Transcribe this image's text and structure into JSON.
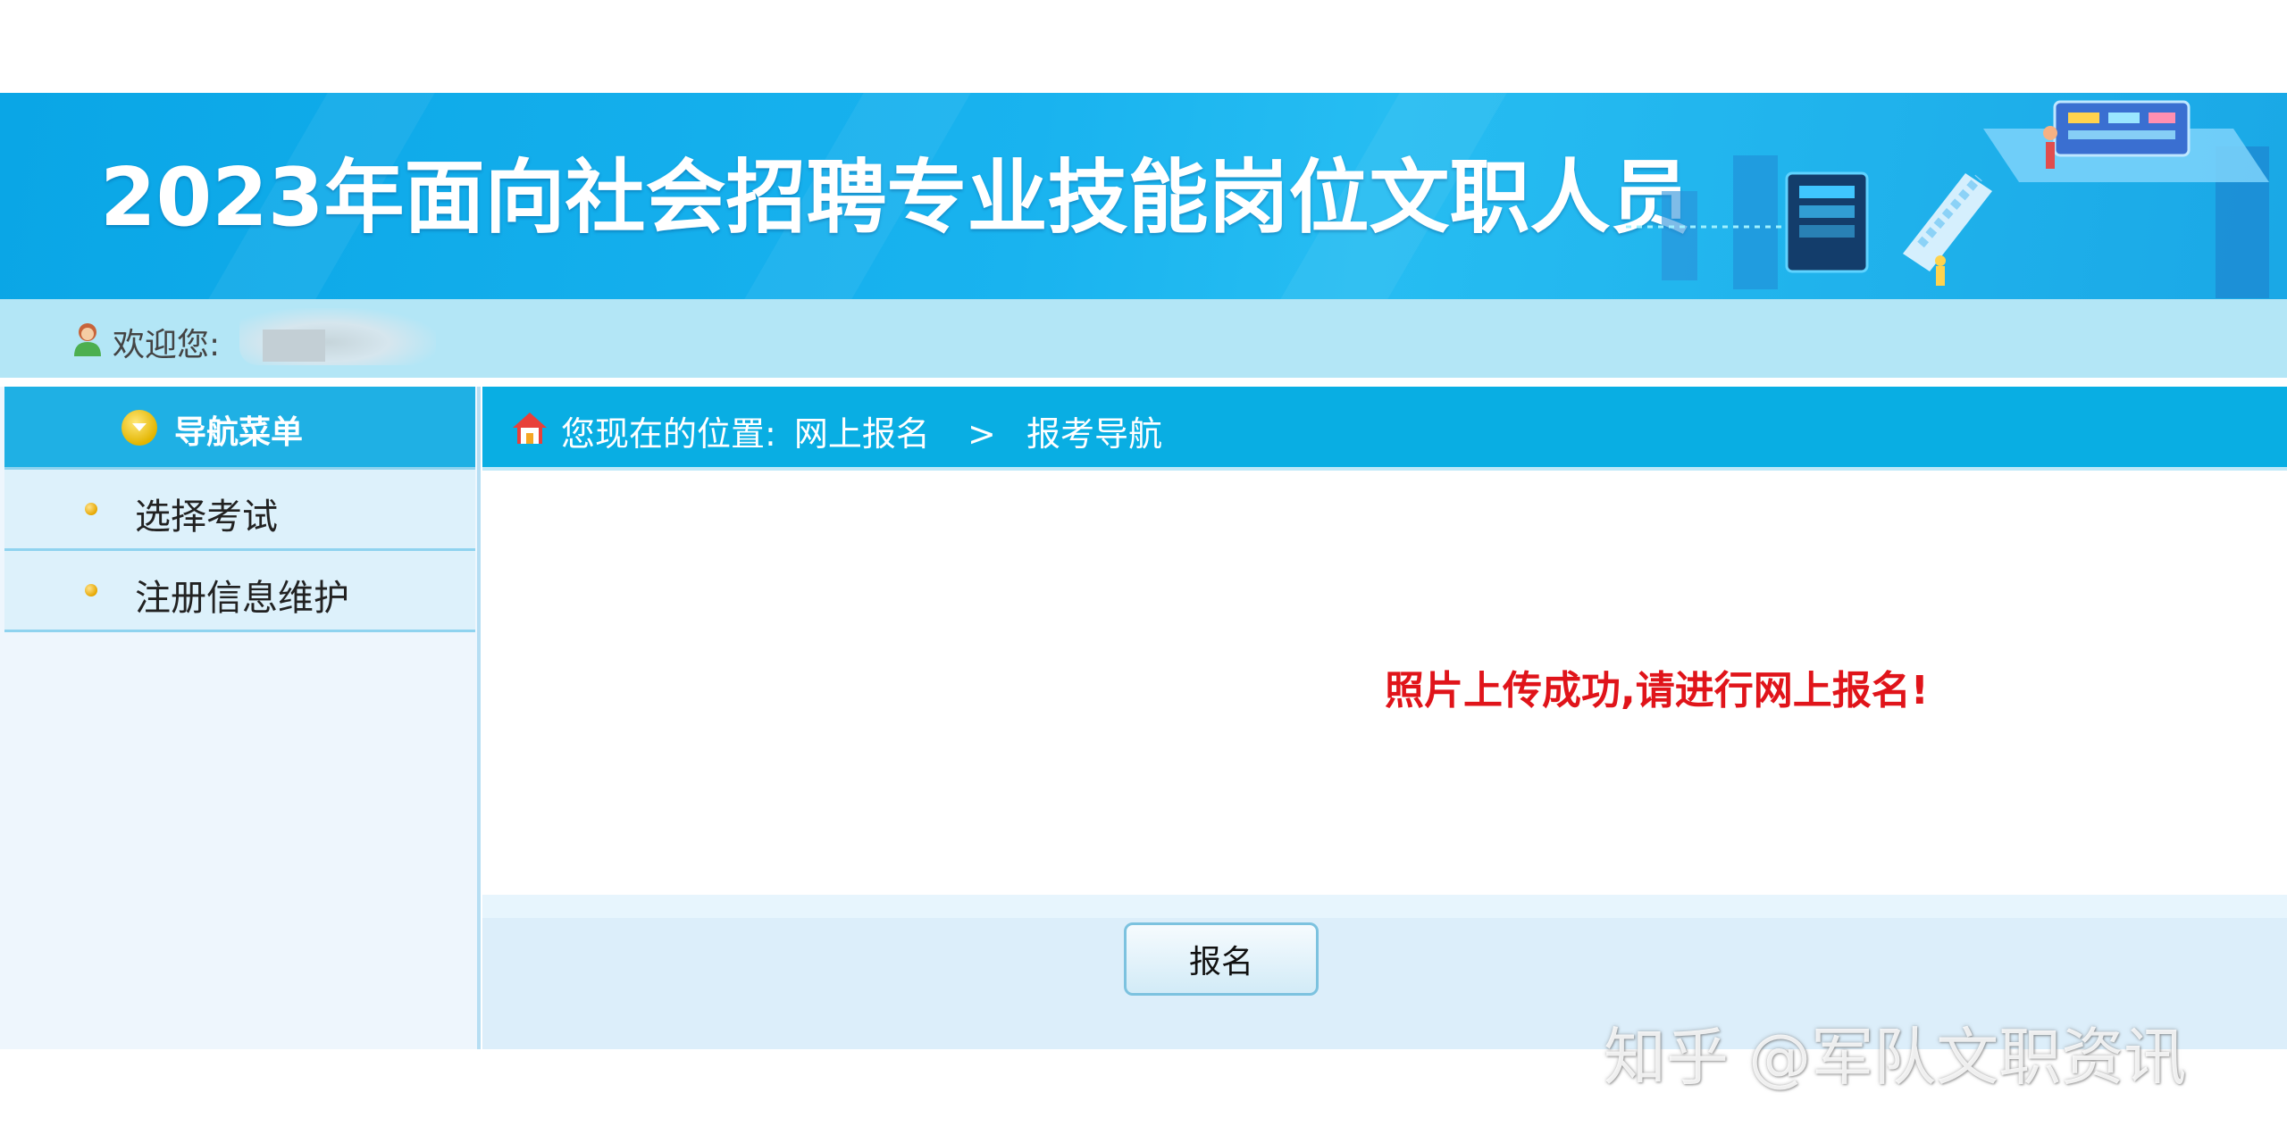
{
  "banner": {
    "title": "2023年面向社会招聘专业技能岗位文职人员"
  },
  "welcome": {
    "label": "欢迎您:",
    "username": ""
  },
  "sidebar": {
    "title": "导航菜单",
    "items": [
      {
        "label": "选择考试"
      },
      {
        "label": "注册信息维护"
      }
    ]
  },
  "breadcrumb": {
    "prefix": "您现在的位置:",
    "items": [
      "网上报名",
      "报考导航"
    ],
    "separator": ">"
  },
  "main": {
    "message": "照片上传成功,请进行网上报名!",
    "submit_label": "报名"
  },
  "watermark": "知乎 @军队文职资讯",
  "colors": {
    "banner": "#0aa6e6",
    "header_bar": "#09aee3",
    "message": "#e0141a",
    "welcome_bar": "#b3e6f6"
  }
}
